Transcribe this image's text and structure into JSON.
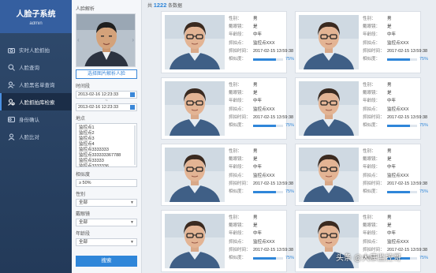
{
  "app": {
    "title": "人脸子系统",
    "user": "admin"
  },
  "nav": [
    {
      "label": "实时人脸抓拍",
      "icon": "camera-icon"
    },
    {
      "label": "人脸查询",
      "icon": "search-icon"
    },
    {
      "label": "人脸黑名单查询",
      "icon": "list-icon"
    },
    {
      "label": "人脸抓拍库检索",
      "icon": "face-search-icon",
      "active": true
    },
    {
      "label": "身份确认",
      "icon": "id-card-icon"
    },
    {
      "label": "人脸比对",
      "icon": "compare-icon"
    }
  ],
  "filter": {
    "face_parse_label": "人脸解析",
    "pick_button": "选择图片解析人脸",
    "time_label": "时间段",
    "time_start": "2013-02-16 12:23:33",
    "time_sep": "~",
    "time_end": "2013-02-16 12:23:33",
    "location_label": "地点",
    "locations": [
      "监控点1",
      "监控点2",
      "监控点3",
      "监控点4",
      "监控点3333333",
      "监控点333333367788",
      "监控点33333",
      "监控点3333336"
    ],
    "similarity_label": "相似度",
    "similarity_value": "≥ 50%",
    "gender_label": "性别",
    "gender_value": "全部",
    "glasses_label": "戴眼镜",
    "glasses_value": "全部",
    "age_label": "年龄段",
    "age_value": "全部",
    "search_button": "搜索"
  },
  "results": {
    "count_prefix": "共",
    "count": "1222",
    "count_suffix": "条数据",
    "labels": {
      "gender": "性别：",
      "glasses": "戴眼镜：",
      "age": "年龄段：",
      "location": "抓拍点：",
      "time": "抓拍时间：",
      "similarity": "相似度："
    },
    "cards": [
      {
        "gender": "男",
        "glasses": "是",
        "age": "中年",
        "location": "监控点XXX",
        "time": "2017-02-15 13:59:38",
        "similarity": "75%",
        "similarity_fraction": 0.75
      },
      {
        "gender": "男",
        "glasses": "是",
        "age": "中年",
        "location": "监控点XXX",
        "time": "2017-02-15 13:59:38",
        "similarity": "75%",
        "similarity_fraction": 0.75
      },
      {
        "gender": "男",
        "glasses": "是",
        "age": "中年",
        "location": "监控点XXX",
        "time": "2017-02-15 13:59:38",
        "similarity": "75%",
        "similarity_fraction": 0.75
      },
      {
        "gender": "男",
        "glasses": "是",
        "age": "中年",
        "location": "监控点XXX",
        "time": "2017-02-15 13:59:38",
        "similarity": "75%",
        "similarity_fraction": 0.75
      },
      {
        "gender": "男",
        "glasses": "是",
        "age": "中年",
        "location": "监控点XXX",
        "time": "2017-02-15 13:59:38",
        "similarity": "75%",
        "similarity_fraction": 0.75
      },
      {
        "gender": "男",
        "glasses": "是",
        "age": "中年",
        "location": "监控点XXX",
        "time": "2017-02-15 13:59:38",
        "similarity": "75%",
        "similarity_fraction": 0.75
      },
      {
        "gender": "男",
        "glasses": "是",
        "age": "中年",
        "location": "监控点XXX",
        "time": "2017-02-15 13:59:38",
        "similarity": "75%",
        "similarity_fraction": 0.75
      },
      {
        "gender": "男",
        "glasses": "是",
        "age": "中年",
        "location": "监控点XXX",
        "time": "2017-02-15 13:59:38",
        "similarity": "75%",
        "similarity_fraction": 0.75
      }
    ]
  },
  "watermark": {
    "text": "头条 @大康监控哥"
  },
  "colors": {
    "accent": "#2f86d9",
    "nav_bg": "#2f4a6d",
    "nav_head": "#355fa0"
  }
}
